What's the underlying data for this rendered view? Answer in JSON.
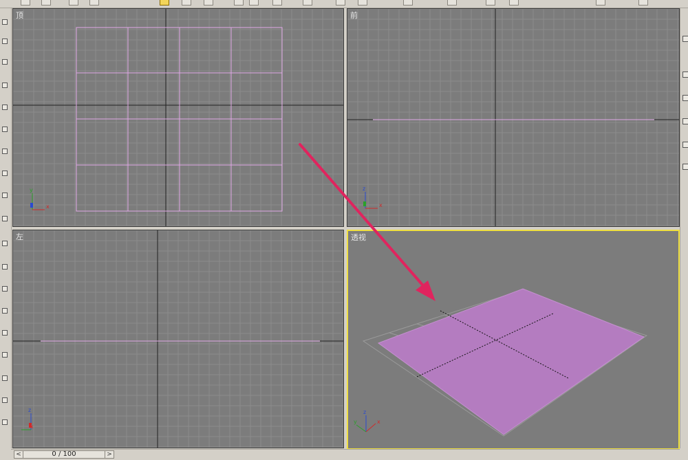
{
  "viewports": {
    "top": {
      "label": "顶"
    },
    "front": {
      "label": "前"
    },
    "left": {
      "label": "左"
    },
    "perspective": {
      "label": "透视"
    }
  },
  "axis_labels": {
    "x": "x",
    "y": "y",
    "z": "z"
  },
  "time_slider": {
    "text": "0 / 100",
    "prev": "<",
    "next": ">"
  },
  "colors": {
    "viewport_bg": "#7c7c7c",
    "grid": "#8c8c8c",
    "plane_wire": "#e0a8e6",
    "plane_fill": "#b47cc0",
    "active_border": "#f0e040",
    "annotation_arrow": "#e0245e"
  }
}
